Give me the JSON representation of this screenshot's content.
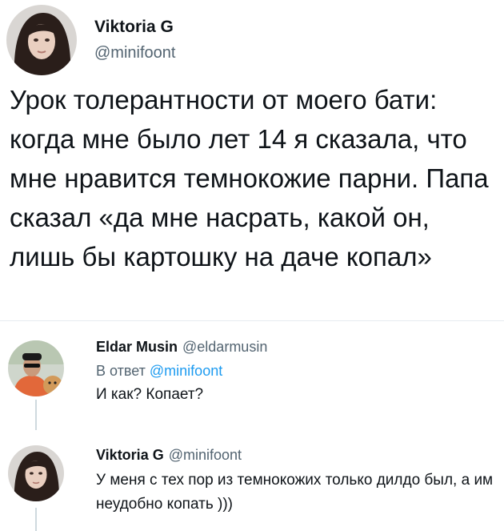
{
  "main_tweet": {
    "author_name": "Viktoria G",
    "author_handle": "@minifoont",
    "text": "Урок толерантности от моего бати: когда мне было лет 14 я сказала, что мне нравится темнокожие парни. Папа сказал «да мне насрать, какой он, лишь бы картошку на даче копал»"
  },
  "replies": [
    {
      "author_name": "Eldar Musin",
      "author_handle": "@eldarmusin",
      "reply_prefix": "В ответ",
      "reply_to": "@minifoont",
      "text": "И как? Копает?"
    },
    {
      "author_name": "Viktoria G",
      "author_handle": "@minifoont",
      "text": "У меня с тех пор из темнокожих только дилдо был, а им неудобно копать )))"
    }
  ],
  "colors": {
    "text": "#0f1419",
    "secondary": "#536471",
    "link": "#1d9bf0",
    "divider": "#e6ecf0"
  }
}
